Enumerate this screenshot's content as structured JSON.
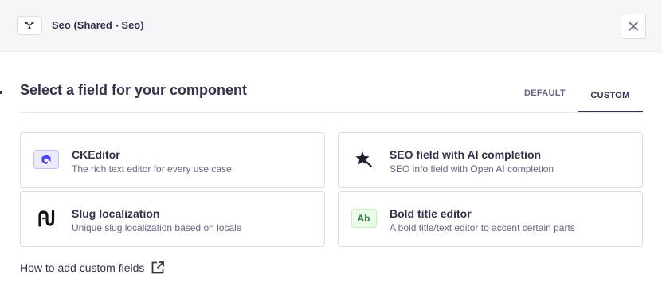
{
  "header": {
    "title": "Seo (Shared - Seo)",
    "component_icon": "component-branch-icon",
    "close_icon": "close-icon"
  },
  "section": {
    "title": "Select a field for your component"
  },
  "tabs": [
    {
      "label": "DEFAULT",
      "active": false
    },
    {
      "label": "CUSTOM",
      "active": true
    }
  ],
  "fields": [
    {
      "title": "CKEditor",
      "description": "The rich text editor for every use case",
      "icon": "ckeditor-icon"
    },
    {
      "title": "SEO field with AI completion",
      "description": "SEO info field with Open AI completion",
      "icon": "star-wand-icon"
    },
    {
      "title": "Slug localization",
      "description": "Unique slug localization based on locale",
      "icon": "slug-icon"
    },
    {
      "title": "Bold title editor",
      "description": "A bold title/text editor to accent certain parts",
      "icon": "ab-icon",
      "badge": "Ab"
    }
  ],
  "help_link": {
    "label": "How to add custom fields",
    "icon": "external-link-icon"
  },
  "colors": {
    "header_bg": "#f6f6f9",
    "text": "#32324d",
    "muted": "#666687",
    "border": "#dcdce4",
    "ck_accent": "#4945ff",
    "ab_green": "#328048"
  }
}
